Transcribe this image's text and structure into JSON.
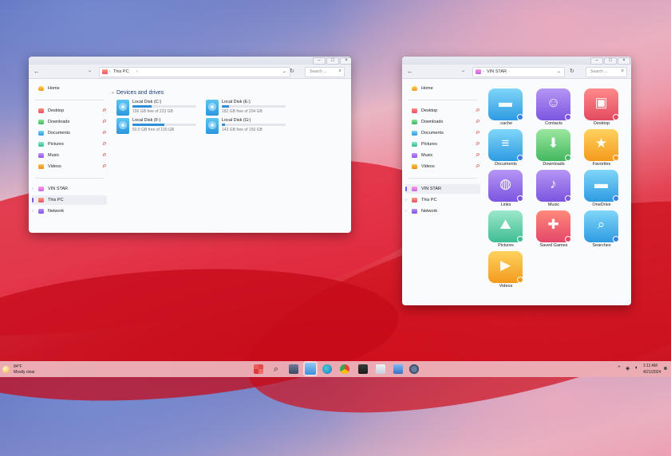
{
  "window1": {
    "path": "This PC",
    "search_placeholder": "Search ...",
    "sidebar": [
      {
        "label": "Home"
      },
      {
        "label": "Desktop"
      },
      {
        "label": "Downloads"
      },
      {
        "label": "Documents"
      },
      {
        "label": "Pictures"
      },
      {
        "label": "Music"
      },
      {
        "label": "Videos"
      },
      {
        "label": "VIN STAR"
      },
      {
        "label": "This PC"
      },
      {
        "label": "Network"
      }
    ],
    "section_title": "Devices and drives",
    "drives": [
      {
        "name": "Local Disk (C:)",
        "free": "156 GB free of 223 GB",
        "usage": 0.3
      },
      {
        "name": "Local Disk (E:)",
        "free": "182 GB free of 204 GB",
        "usage": 0.11
      },
      {
        "name": "Local Disk (F:)",
        "free": "50.5 GB free of 100 GB",
        "usage": 0.5
      },
      {
        "name": "Local Disk (G:)",
        "free": "143 GB free of 150 GB",
        "usage": 0.05
      }
    ]
  },
  "window2": {
    "path": "VIN STAR",
    "search_placeholder": "Search ...",
    "sidebar": [
      {
        "label": "Home"
      },
      {
        "label": "Desktop"
      },
      {
        "label": "Downloads"
      },
      {
        "label": "Documents"
      },
      {
        "label": "Pictures"
      },
      {
        "label": "Music"
      },
      {
        "label": "Videos"
      },
      {
        "label": "VIN STAR"
      },
      {
        "label": "This PC"
      },
      {
        "label": "Network"
      }
    ],
    "folders": [
      {
        "label": ".cache"
      },
      {
        "label": "Contacts"
      },
      {
        "label": "Desktop"
      },
      {
        "label": "Documents"
      },
      {
        "label": "Downloads"
      },
      {
        "label": "Favorites"
      },
      {
        "label": "Links"
      },
      {
        "label": "Music"
      },
      {
        "label": "OneDrive"
      },
      {
        "label": "Pictures"
      },
      {
        "label": "Saved Games"
      },
      {
        "label": "Searches"
      },
      {
        "label": "Videos"
      }
    ]
  },
  "taskbar": {
    "temperature": "84°F",
    "weather": "Mostly clear",
    "time": "1:11 AM",
    "date": "4/21/2024"
  }
}
